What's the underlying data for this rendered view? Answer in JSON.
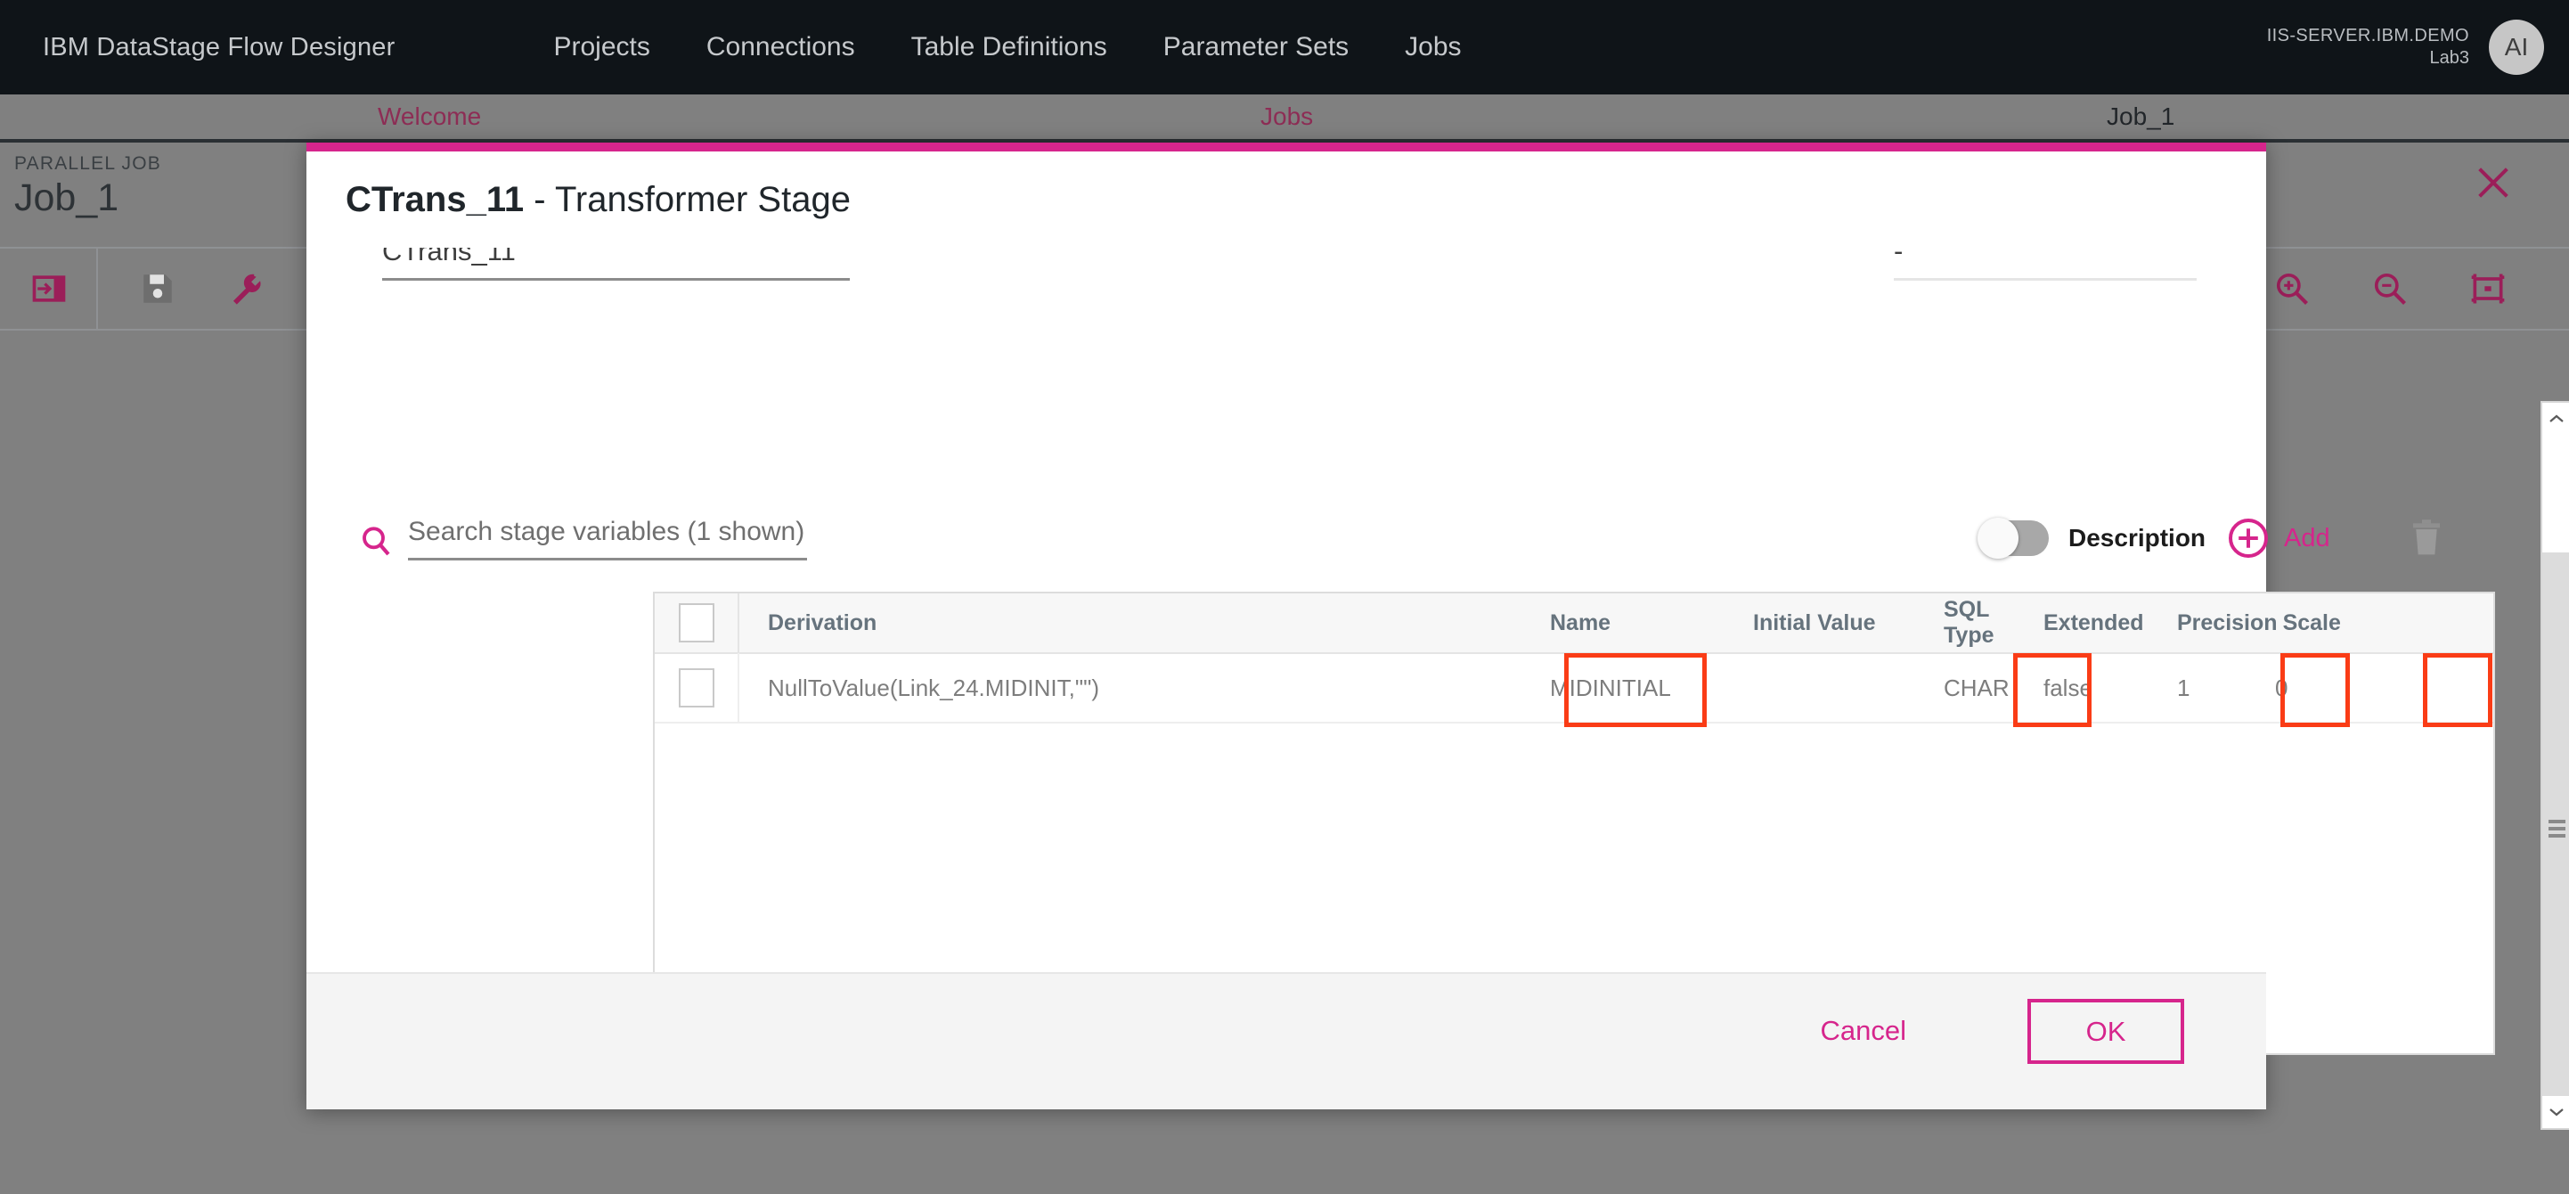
{
  "topnav": {
    "brand": "IBM DataStage Flow Designer",
    "links": [
      {
        "label": "Projects"
      },
      {
        "label": "Connections"
      },
      {
        "label": "Table Definitions"
      },
      {
        "label": "Parameter Sets"
      },
      {
        "label": "Jobs"
      }
    ],
    "server_line1": "IIS-SERVER.IBM.DEMO",
    "server_line2": "Lab3",
    "avatar_initials": "AI"
  },
  "tabs": [
    {
      "label": "Welcome",
      "active": false
    },
    {
      "label": "Jobs",
      "active": false
    },
    {
      "label": "Job_1",
      "active": true
    }
  ],
  "job": {
    "kind_label": "PARALLEL JOB",
    "title": "Job_1"
  },
  "toolbar": {
    "items": [
      {
        "name": "open-job-icon"
      },
      {
        "name": "save-icon"
      },
      {
        "name": "settings-wrench-icon"
      },
      {
        "name": "zoom-in-icon"
      },
      {
        "name": "zoom-out-icon"
      },
      {
        "name": "fit-to-screen-icon"
      }
    ]
  },
  "dialog": {
    "title_name": "CTrans_11",
    "title_sep": " - ",
    "title_rest": "Transformer Stage",
    "stage_name_value": "CTrans_11",
    "secondary_field_value": "-",
    "search": {
      "placeholder": "Search stage variables (1 shown)",
      "value": ""
    },
    "description_toggle": {
      "label": "Description",
      "state": "off"
    },
    "add_label": "Add",
    "delete_icon": "trash-icon",
    "table": {
      "columns": [
        "Derivation",
        "Name",
        "Initial Value",
        "SQL Type",
        "Extended",
        "Precision",
        "Scale"
      ],
      "rows": [
        {
          "derivation": "NullToValue(Link_24.MIDINIT,\"\")",
          "name": "MIDINITIAL",
          "initial_value": "",
          "sql_type": "CHAR",
          "extended": "false",
          "precision": "1",
          "scale": "0"
        }
      ]
    },
    "footer": {
      "cancel_label": "Cancel",
      "ok_label": "OK"
    }
  },
  "colors": {
    "accent_pink": "#d6258c",
    "nav_dark": "#0f1418",
    "annotation_red": "#fa3c16",
    "muted_text": "#7d7d7d"
  }
}
